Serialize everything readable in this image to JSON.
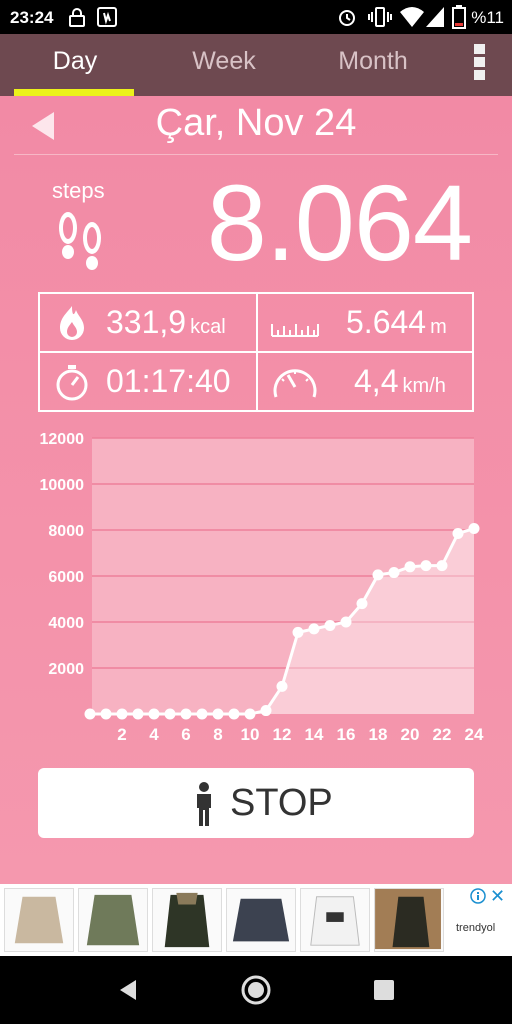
{
  "status_bar": {
    "time": "23:24",
    "battery": "%11",
    "icons": [
      "lock-icon",
      "vibration-app-icon",
      "alarm-icon",
      "vibrate-icon",
      "wifi-icon",
      "signal-icon",
      "battery-icon"
    ]
  },
  "tabs": [
    {
      "label": "Day",
      "active": true
    },
    {
      "label": "Week",
      "active": false
    },
    {
      "label": "Month",
      "active": false
    }
  ],
  "colors": {
    "background_pink": "#f28aa5",
    "tab_bar": "#6e4950",
    "tab_indicator": "#ecf21a",
    "chart_line": "#ffffff"
  },
  "date": {
    "label": "Çar, Nov 24"
  },
  "steps": {
    "label": "steps",
    "value": "8.064"
  },
  "stats": {
    "calories": {
      "value": "331,9",
      "unit": "kcal",
      "icon": "flame-icon"
    },
    "distance": {
      "value": "5.644",
      "unit": "m",
      "icon": "ruler-icon"
    },
    "duration": {
      "value": "01:17:40",
      "icon": "stopwatch-icon"
    },
    "speed": {
      "value": "4,4",
      "unit": "km/h",
      "icon": "speedometer-icon"
    }
  },
  "chart_data": {
    "type": "area",
    "title": "",
    "xlabel": "",
    "ylabel": "",
    "x": [
      0,
      1,
      2,
      3,
      4,
      5,
      6,
      7,
      8,
      9,
      10,
      11,
      12,
      13,
      14,
      15,
      16,
      17,
      18,
      19,
      20,
      21,
      22,
      23,
      24
    ],
    "xticks": [
      "2",
      "4",
      "6",
      "8",
      "10",
      "12",
      "14",
      "16",
      "18",
      "20",
      "22",
      "24"
    ],
    "yticks": [
      "2000",
      "4000",
      "6000",
      "8000",
      "10000",
      "12000"
    ],
    "values": [
      0,
      0,
      0,
      0,
      0,
      0,
      0,
      0,
      0,
      0,
      0,
      150,
      1200,
      3550,
      3700,
      3850,
      4000,
      4800,
      6050,
      6150,
      6400,
      6450,
      6450,
      7850,
      8064
    ],
    "ylim": [
      0,
      12000
    ],
    "xlim": [
      0,
      24
    ],
    "grid": true
  },
  "stop_button": {
    "label": "STOP",
    "icon": "person-icon"
  },
  "ad": {
    "items": [
      "fleece-jacket",
      "military-jacket",
      "parka-jacket",
      "navy-sweater",
      "white-hoodie",
      "jacket-model"
    ],
    "brand": "trendyol"
  },
  "nav": {
    "buttons": [
      "back-icon",
      "home-icon",
      "recents-icon"
    ]
  }
}
